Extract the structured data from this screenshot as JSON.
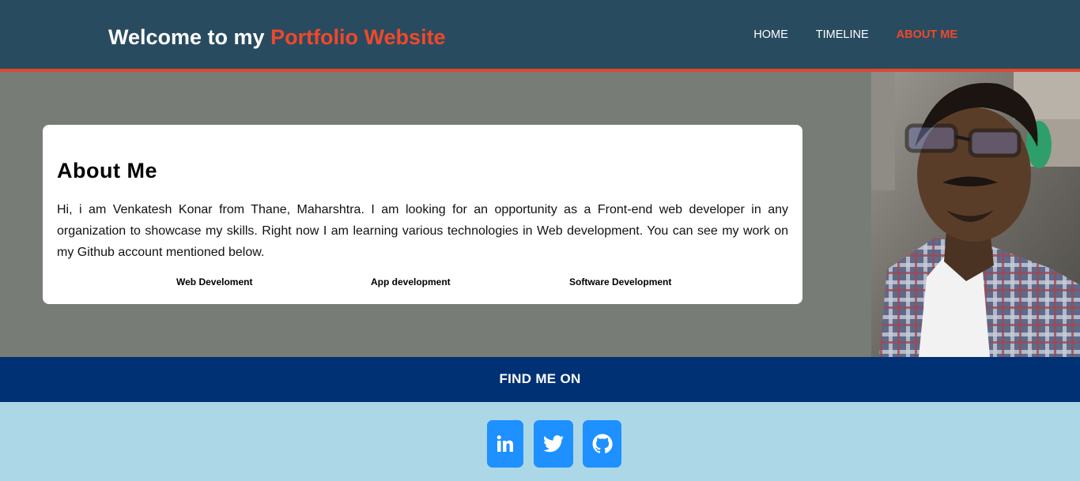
{
  "header": {
    "title_prefix": "Welcome to my ",
    "title_accent": "Portfolio Website",
    "nav": [
      {
        "label": "HOME"
      },
      {
        "label": "TIMELINE"
      },
      {
        "label": "ABOUT ME"
      }
    ]
  },
  "about": {
    "heading": "About Me",
    "body": "Hi, i am Venkatesh Konar from Thane, Maharshtra. I am looking for an opportunity as a Front-end web developer in any organization to showcase my skills. Right now I am learning various technologies in Web development. You can see my work on my Github account mentioned below.",
    "skills": [
      "Web Develoment",
      "App development",
      "Software Development"
    ]
  },
  "photo": {
    "icon": "profile-photo"
  },
  "findme": {
    "label": "FIND ME ON"
  },
  "socials": [
    {
      "icon": "linkedin-icon"
    },
    {
      "icon": "twitter-icon"
    },
    {
      "icon": "github-icon"
    }
  ],
  "colors": {
    "header_bg": "#294b60",
    "accent": "#f0482a",
    "main_bg": "#777c76",
    "findme_bg": "#003174",
    "footer_bg": "#acd7e6",
    "social_btn": "#1e90ff"
  }
}
